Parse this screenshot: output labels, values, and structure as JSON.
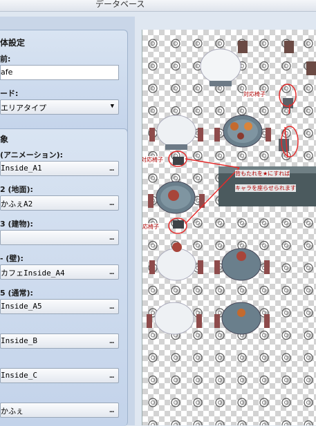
{
  "window": {
    "title": "データベース"
  },
  "general": {
    "header": "体設定",
    "name_label": "前:",
    "name_value": "afe",
    "mode_label": "ード:",
    "mode_value": "エリアタイプ"
  },
  "images": {
    "header": "象",
    "slots": [
      {
        "label": "(アニメーション):",
        "value": "Inside_A1"
      },
      {
        "label": "2 (地面):",
        "value": "かふぇA2"
      },
      {
        "label": "3 (建物):",
        "value": ""
      },
      {
        "label": "- (壁):",
        "value": "カフェInside_A4"
      },
      {
        "label": "5 (通常):",
        "value": "Inside_A5"
      },
      {
        "label": "",
        "value": "Inside_B"
      },
      {
        "label": "",
        "value": "Inside_C"
      },
      {
        "label": "",
        "value": "かふぇ"
      }
    ],
    "browse_label": "…"
  },
  "annotations": {
    "a1": "対応椅子",
    "a2": "対応椅子",
    "a3": "対応椅子",
    "a4_line1": "背もたれを★にすれば",
    "a4_line2": "キャラを座らせられます"
  },
  "colors": {
    "annotation_red": "#e52b2b",
    "panel_blue": "#c3d3ea"
  }
}
